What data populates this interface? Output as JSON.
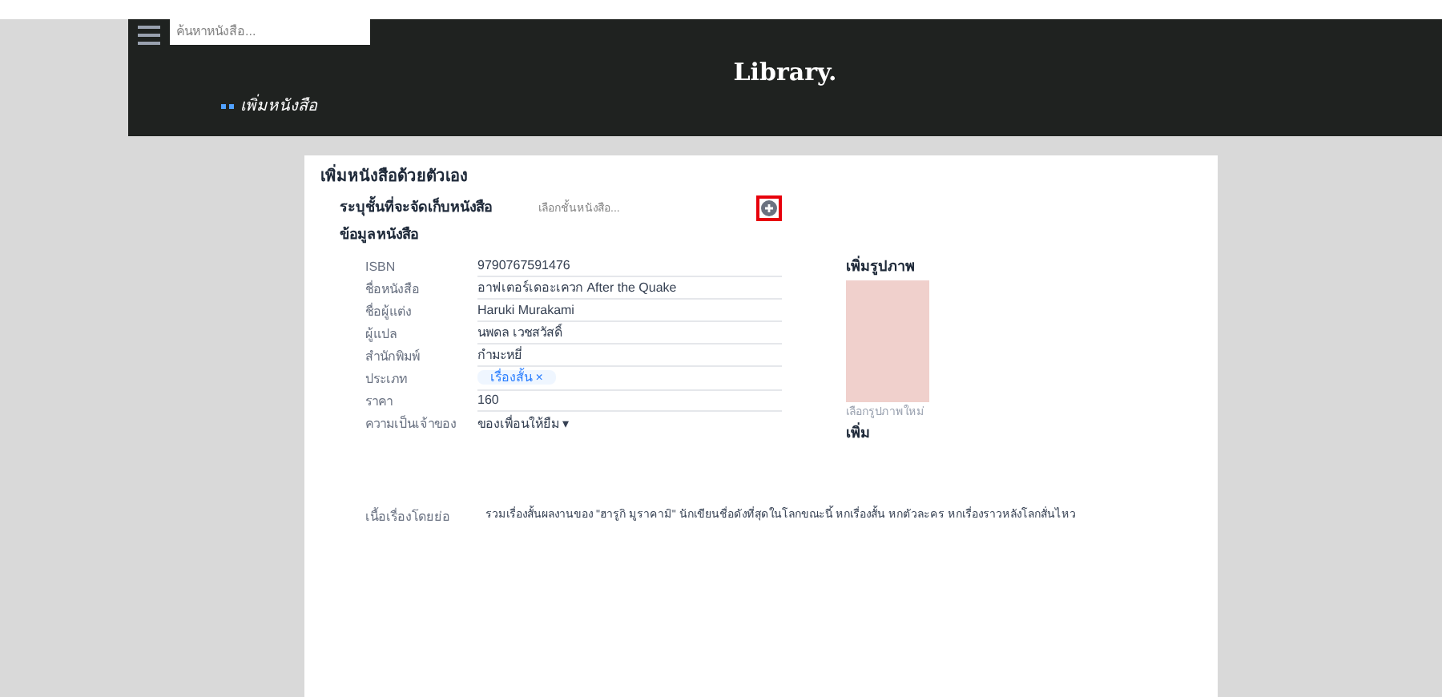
{
  "header": {
    "search": {
      "placeholder": "ค้นหาหนังสือ..."
    },
    "title": "Library.",
    "breadcrumb": "เพิ่มหนังสือ"
  },
  "form": {
    "heading": "เพิ่มหนังสือด้วยตัวเอง",
    "shelf_label": "ระบุชั้นที่จะจัดเก็บหนังสือ",
    "shelf_placeholder": "เลือกชั้นหนังสือ...",
    "section": "ข้อมูลหนังสือ",
    "fields": [
      {
        "kind": "text",
        "label": "ISBN",
        "value": "9790767591476"
      },
      {
        "kind": "text",
        "label": "ชื่อหนังสือ",
        "value": "อาฟเตอร์เดอะเควก After the Quake"
      },
      {
        "kind": "text",
        "label": "ชื่อผู้แต่ง",
        "value": "Haruki Murakami"
      },
      {
        "kind": "text",
        "label": "ผู้แปล",
        "value": "นพดล เวชสวัสดิ์"
      },
      {
        "kind": "text",
        "label": "สำนักพิมพ์",
        "value": "กำมะหยี่"
      },
      {
        "kind": "tag",
        "label": "ประเภท",
        "value": "เรื่องสั้น ×"
      },
      {
        "kind": "text",
        "label": "ราคา",
        "value": "160"
      },
      {
        "kind": "select",
        "label": "ความเป็นเจ้าของ",
        "value": "ของเพื่อนให้ยืม ▾"
      }
    ],
    "image": {
      "label": "เพิ่มรูปภาพ",
      "caption": "เลือกรูปภาพใหม่",
      "button": "เพิ่ม"
    },
    "summary": {
      "label": "เนื้อเรื่องโดยย่อ",
      "value": "รวมเรื่องสั้นผลงานของ \"ฮารูกิ มูราคามิ\" นักเขียนชื่อดังที่สุดในโลกขณะนี้ หกเรื่องสั้น หกตัวละคร หกเรื่องราวหลังโลกสั่นไหว"
    }
  }
}
